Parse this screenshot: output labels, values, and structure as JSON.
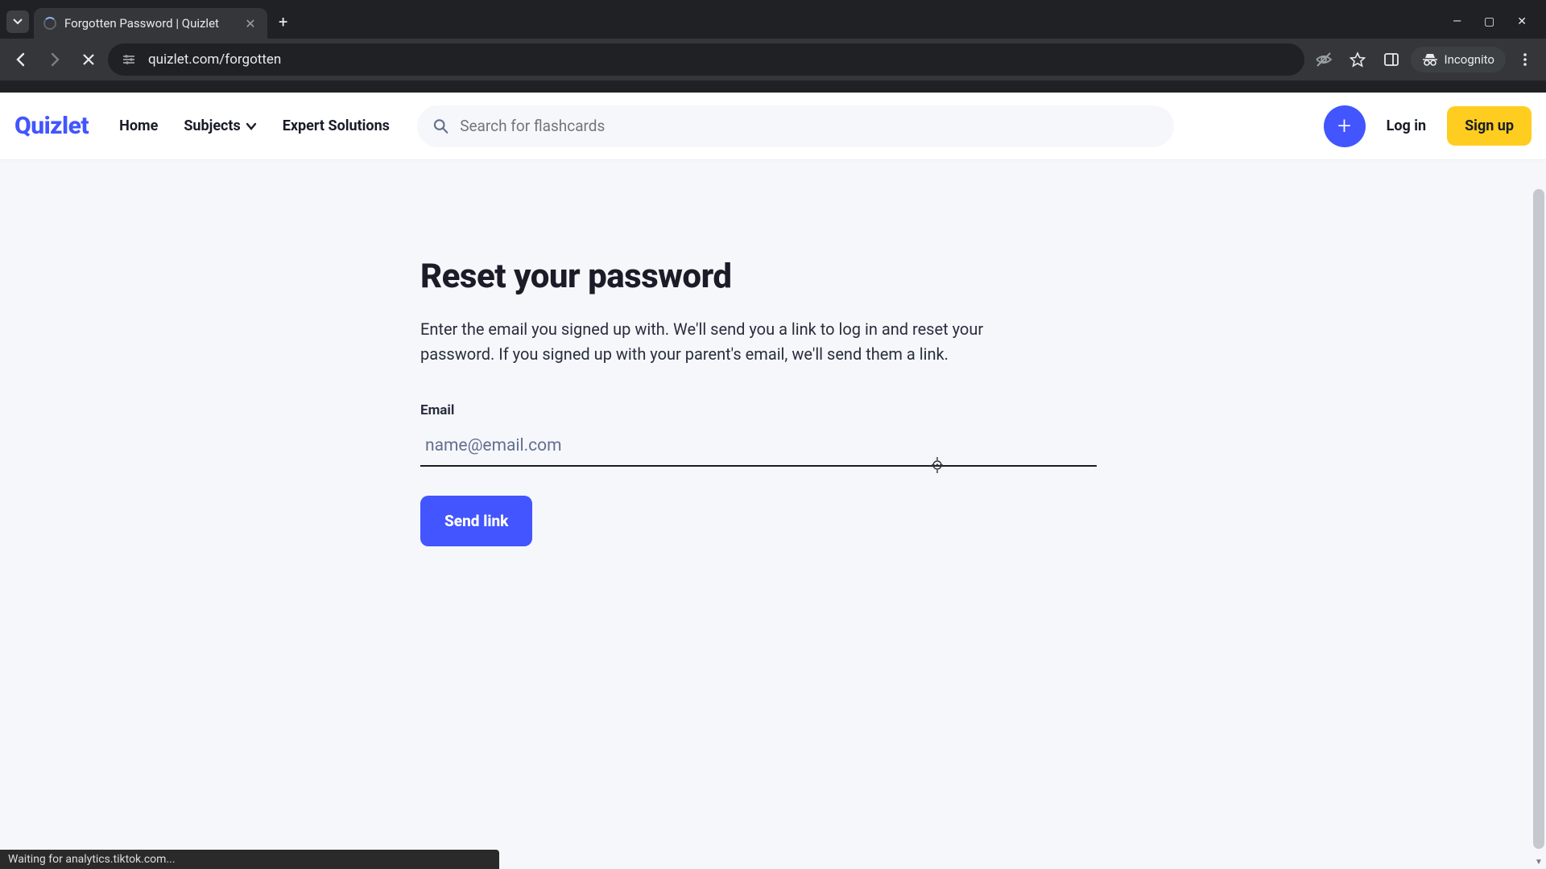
{
  "browser": {
    "tab_title": "Forgotten Password | Quizlet",
    "url": "quizlet.com/forgotten",
    "incognito_label": "Incognito",
    "status_text": "Waiting for analytics.tiktok.com..."
  },
  "header": {
    "logo_text": "Quizlet",
    "nav": {
      "home": "Home",
      "subjects": "Subjects",
      "expert": "Expert Solutions"
    },
    "search_placeholder": "Search for flashcards",
    "login": "Log in",
    "signup": "Sign up"
  },
  "main": {
    "heading": "Reset your password",
    "description": "Enter the email you signed up with. We'll send you a link to log in and reset your password. If you signed up with your parent's email, we'll send them a link.",
    "email_label": "Email",
    "email_placeholder": "name@email.com",
    "submit": "Send link"
  }
}
